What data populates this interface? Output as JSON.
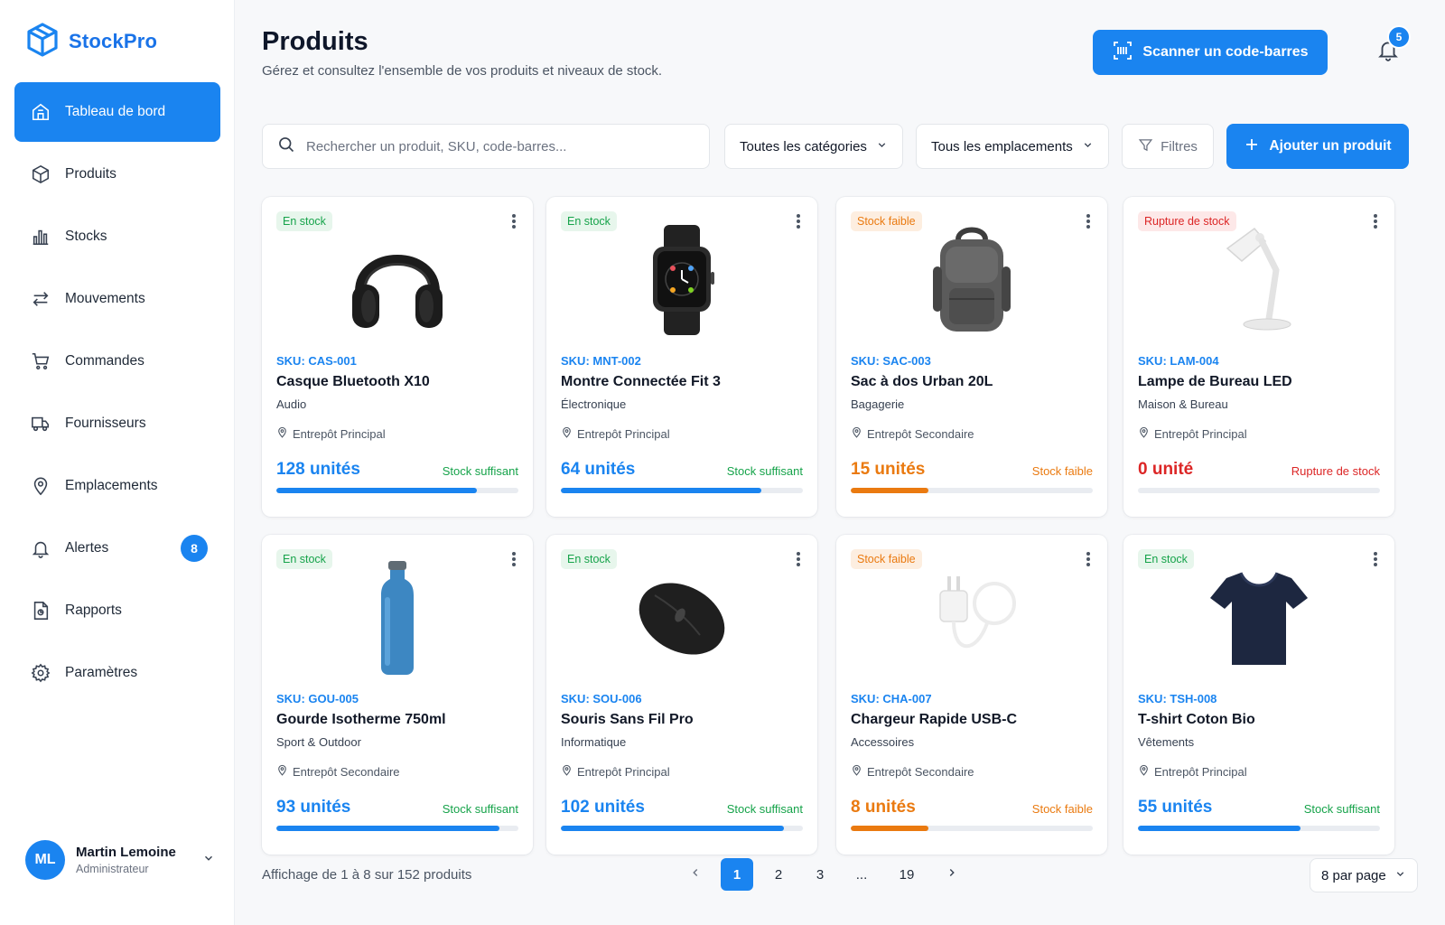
{
  "brand": {
    "name": "StockPro",
    "color": "#1a84f0"
  },
  "sidebar": {
    "items": [
      {
        "label": "Tableau de bord",
        "icon": "home-icon",
        "active": true
      },
      {
        "label": "Produits",
        "icon": "box-icon"
      },
      {
        "label": "Stocks",
        "icon": "bar-chart-icon"
      },
      {
        "label": "Mouvements",
        "icon": "arrows-swap-icon"
      },
      {
        "label": "Commandes",
        "icon": "cart-icon"
      },
      {
        "label": "Fournisseurs",
        "icon": "truck-icon"
      },
      {
        "label": "Emplacements",
        "icon": "map-pin-icon"
      },
      {
        "label": "Alertes",
        "icon": "bell-icon",
        "badge": "8"
      },
      {
        "label": "Rapports",
        "icon": "report-icon"
      },
      {
        "label": "Paramètres",
        "icon": "gear-icon"
      }
    ],
    "user": {
      "initials": "ML",
      "name": "Martin Lemoine",
      "role": "Administrateur"
    }
  },
  "header": {
    "title": "Produits",
    "subtitle": "Gérez et consultez l'ensemble de vos produits et niveaux de stock.",
    "scan_label": "Scanner un code-barres",
    "notifications": "5"
  },
  "toolbar": {
    "search_placeholder": "Rechercher un produit, SKU, code-barres...",
    "category_select": "Toutes les catégories",
    "location_select": "Tous les emplacements",
    "filters_label": "Filtres",
    "add_label": "Ajouter un produit"
  },
  "products": [
    {
      "badge": "En stock",
      "status": "ok",
      "image": "headphones",
      "sku": "SKU: CAS-001",
      "name": "Casque Bluetooth X10",
      "category": "Audio",
      "location": "Entrepôt Principal",
      "qty": "128 unités",
      "stock_status": "Stock suffisant",
      "level": 0.83
    },
    {
      "badge": "En stock",
      "status": "ok",
      "image": "smartwatch",
      "sku": "SKU: MNT-002",
      "name": "Montre Connectée Fit 3",
      "category": "Électronique",
      "location": "Entrepôt Principal",
      "qty": "64 unités",
      "stock_status": "Stock suffisant",
      "level": 0.83
    },
    {
      "badge": "Stock faible",
      "status": "low",
      "image": "backpack",
      "sku": "SKU: SAC-003",
      "name": "Sac à dos Urban 20L",
      "category": "Bagagerie",
      "location": "Entrepôt Secondaire",
      "qty": "15 unités",
      "stock_status": "Stock faible",
      "level": 0.32
    },
    {
      "badge": "Rupture de stock",
      "status": "out",
      "image": "desk-lamp",
      "sku": "SKU: LAM-004",
      "name": "Lampe de Bureau LED",
      "category": "Maison & Bureau",
      "location": "Entrepôt Principal",
      "qty": "0 unité",
      "stock_status": "Rupture de stock",
      "level": 0
    },
    {
      "badge": "En stock",
      "status": "ok",
      "image": "bottle",
      "sku": "SKU: GOU-005",
      "name": "Gourde Isotherme 750ml",
      "category": "Sport & Outdoor",
      "location": "Entrepôt Secondaire",
      "qty": "93 unités",
      "stock_status": "Stock suffisant",
      "level": 0.92
    },
    {
      "badge": "En stock",
      "status": "ok",
      "image": "mouse",
      "sku": "SKU: SOU-006",
      "name": "Souris Sans Fil Pro",
      "category": "Informatique",
      "location": "Entrepôt Principal",
      "qty": "102 unités",
      "stock_status": "Stock suffisant",
      "level": 0.92
    },
    {
      "badge": "Stock faible",
      "status": "low",
      "image": "charger",
      "sku": "SKU: CHA-007",
      "name": "Chargeur Rapide USB-C",
      "category": "Accessoires",
      "location": "Entrepôt Secondaire",
      "qty": "8 unités",
      "stock_status": "Stock faible",
      "level": 0.32
    },
    {
      "badge": "En stock",
      "status": "ok",
      "image": "tshirt",
      "sku": "SKU: TSH-008",
      "name": "T-shirt Coton Bio",
      "category": "Vêtements",
      "location": "Entrepôt Principal",
      "qty": "55 unités",
      "stock_status": "Stock suffisant",
      "level": 0.67
    }
  ],
  "footer": {
    "showing": "Affichage de 1 à 8 sur 152 produits",
    "pages": [
      "1",
      "2",
      "3",
      "...",
      "19"
    ],
    "current_page": "1",
    "per_page": "8 par page"
  }
}
